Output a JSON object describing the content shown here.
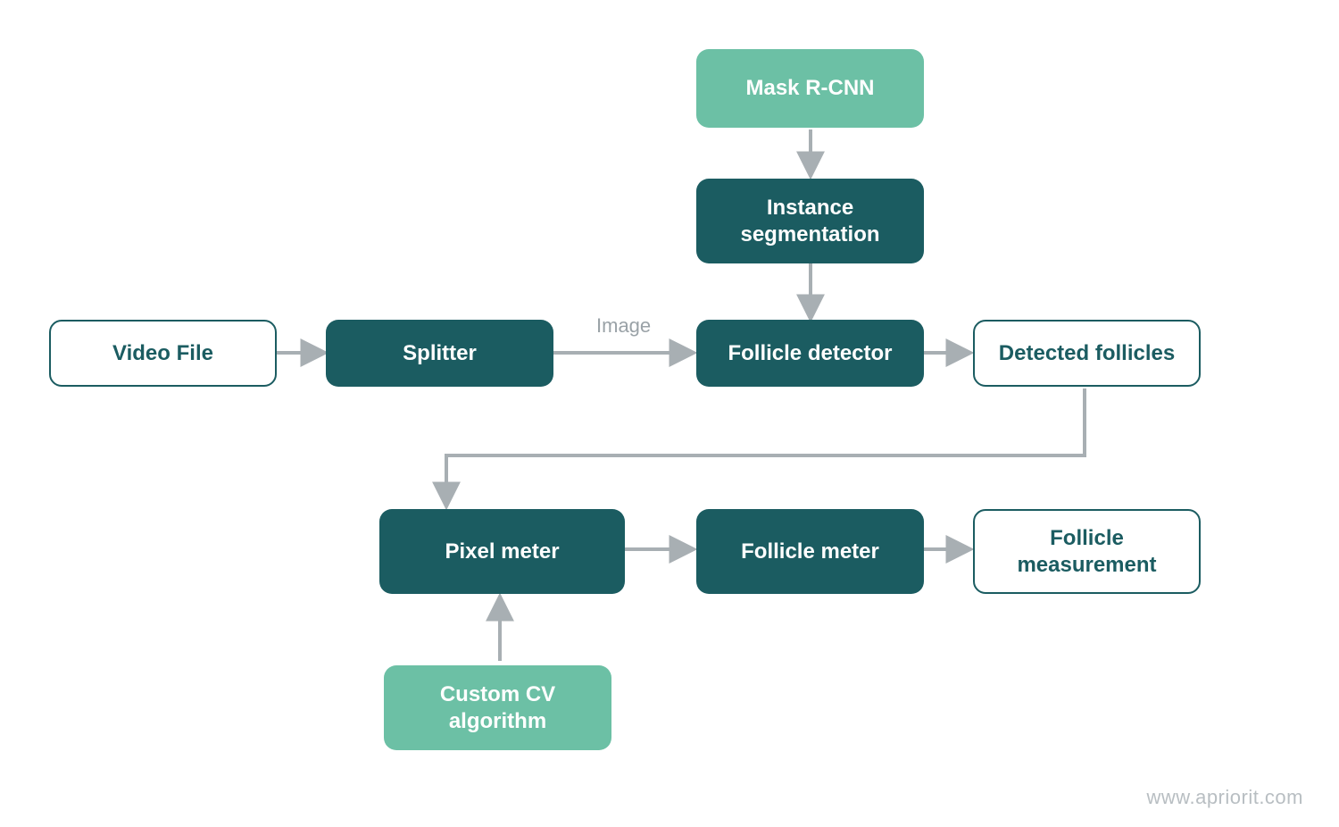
{
  "nodes": {
    "video_file": "Video File",
    "splitter": "Splitter",
    "follicle_detector": "Follicle detector",
    "detected_follicles": "Detected follicles",
    "mask_rcnn": "Mask R-CNN",
    "instance_segmentation": "Instance\nsegmentation",
    "pixel_meter": "Pixel meter",
    "follicle_meter": "Follicle meter",
    "follicle_measurement": "Follicle\nmeasurement",
    "custom_cv": "Custom CV\nalgorithm"
  },
  "edges": {
    "image_label": "Image"
  },
  "footer": "www.apriorit.com",
  "colors": {
    "dark": "#1b5c61",
    "light": "#6cc0a5",
    "arrow": "#a8afb3",
    "text_muted": "#9aa2a7"
  }
}
